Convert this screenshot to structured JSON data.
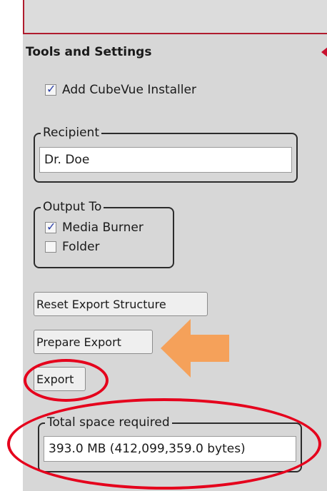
{
  "panel": {
    "header": {
      "title": "Tools and Settings"
    },
    "add_installer": {
      "label": "Add CubeVue Installer",
      "checked": true
    },
    "recipient": {
      "legend": "Recipient",
      "value": "Dr. Doe"
    },
    "output_to": {
      "legend": "Output To",
      "options": [
        {
          "label": "Media Burner",
          "checked": true
        },
        {
          "label": "Folder",
          "checked": false
        }
      ]
    },
    "buttons": {
      "reset": "Reset Export Structure",
      "prepare": "Prepare Export",
      "export": "Export"
    },
    "space": {
      "legend": "Total space required",
      "value": "393.0 MB (412,099,359.0 bytes)"
    }
  },
  "colors": {
    "panel_bg": "#d7d7d7",
    "annotation_red": "#e5001c",
    "annotation_orange": "#f5a15a",
    "header_accent": "#c8102e"
  }
}
